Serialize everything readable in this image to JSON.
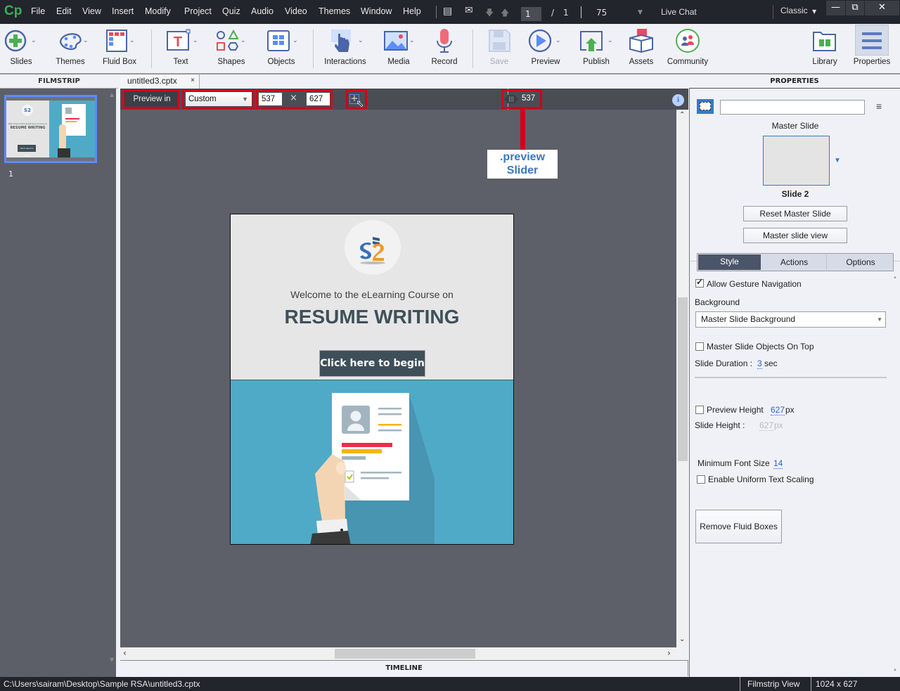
{
  "app": {
    "logo": "Cp"
  },
  "menu": [
    "File",
    "Edit",
    "View",
    "Insert",
    "Modify",
    "Project",
    "Quiz",
    "Audio",
    "Video",
    "Themes",
    "Window",
    "Help"
  ],
  "topbar": {
    "current_page": "1",
    "page_separator": "/",
    "total_pages": "1",
    "zoom": "75",
    "live_chat": "Live Chat",
    "workspace": "Classic"
  },
  "toolbar": {
    "items": [
      {
        "label": "Slides",
        "icon": "add-slide-icon"
      },
      {
        "label": "Themes",
        "icon": "palette-icon"
      },
      {
        "label": "Fluid Box",
        "icon": "fluid-box-icon"
      },
      {
        "label": "Text",
        "icon": "text-icon"
      },
      {
        "label": "Shapes",
        "icon": "shapes-icon"
      },
      {
        "label": "Objects",
        "icon": "objects-icon"
      },
      {
        "label": "Interactions",
        "icon": "interactions-icon"
      },
      {
        "label": "Media",
        "icon": "media-icon"
      },
      {
        "label": "Record",
        "icon": "microphone-icon"
      },
      {
        "label": "Save",
        "icon": "save-icon",
        "disabled": true
      },
      {
        "label": "Preview",
        "icon": "play-icon"
      },
      {
        "label": "Publish",
        "icon": "publish-icon"
      },
      {
        "label": "Assets",
        "icon": "assets-icon"
      },
      {
        "label": "Community",
        "icon": "community-icon"
      },
      {
        "label": "Library",
        "icon": "library-icon"
      },
      {
        "label": "Properties",
        "icon": "properties-icon",
        "active": true
      }
    ]
  },
  "filmstrip": {
    "title": "FILMSTRIP",
    "slides": [
      {
        "number": "1"
      }
    ]
  },
  "document": {
    "tab": "untitled3.cptx",
    "close": "×"
  },
  "preview_bar": {
    "preview_in": "Preview in",
    "device": "Custom",
    "width": "537",
    "times": "×",
    "height": "627",
    "slider_value": "537",
    "annotation": ".preview\nSlider",
    "annotation_line1": ".preview",
    "annotation_line2": "Slider"
  },
  "slide": {
    "welcome": "Welcome to the eLearning Course on",
    "title": "RESUME WRITING",
    "button": "Click here to begin",
    "thumb_welcome": "Welcome to the eLearning Course on",
    "thumb_title": "RESUME WRITING",
    "thumb_button": "Click here to begin"
  },
  "timeline": {
    "title": "TIMELINE"
  },
  "properties": {
    "title": "PROPERTIES",
    "name_value": "",
    "master_slide_label": "Master Slide",
    "master_slide_name": "Slide 2",
    "reset_master": "Reset Master Slide",
    "master_view": "Master slide view",
    "tabs": [
      "Style",
      "Actions",
      "Options"
    ],
    "active_tab": "Style",
    "allow_gesture": {
      "label": "Allow Gesture Navigation",
      "checked": true
    },
    "background_label": "Background",
    "background_value": "Master Slide Background",
    "master_on_top": {
      "label": "Master Slide Objects On Top",
      "checked": false
    },
    "slide_duration_label": "Slide Duration :",
    "slide_duration_value": "3",
    "slide_duration_unit": "sec",
    "preview_height": {
      "label": "Preview Height",
      "value": "627",
      "unit": "px",
      "checked": false
    },
    "slide_height_label": "Slide Height :",
    "slide_height_value": "627",
    "slide_height_unit": "px",
    "min_font_label": "Minimum Font Size",
    "min_font_value": "14",
    "uniform_scaling": {
      "label": "Enable Uniform Text Scaling",
      "checked": false
    },
    "remove_fluid": "Remove Fluid Boxes"
  },
  "statusbar": {
    "path": "C:\\Users\\sairam\\Desktop\\Sample RSA\\untitled3.cptx",
    "view": "Filmstrip View",
    "size": "1024 x 627"
  },
  "colors": {
    "accent": "#d4001b",
    "brand": "#3fae5b",
    "selection": "#5a8cff",
    "link": "#2a62c9"
  }
}
